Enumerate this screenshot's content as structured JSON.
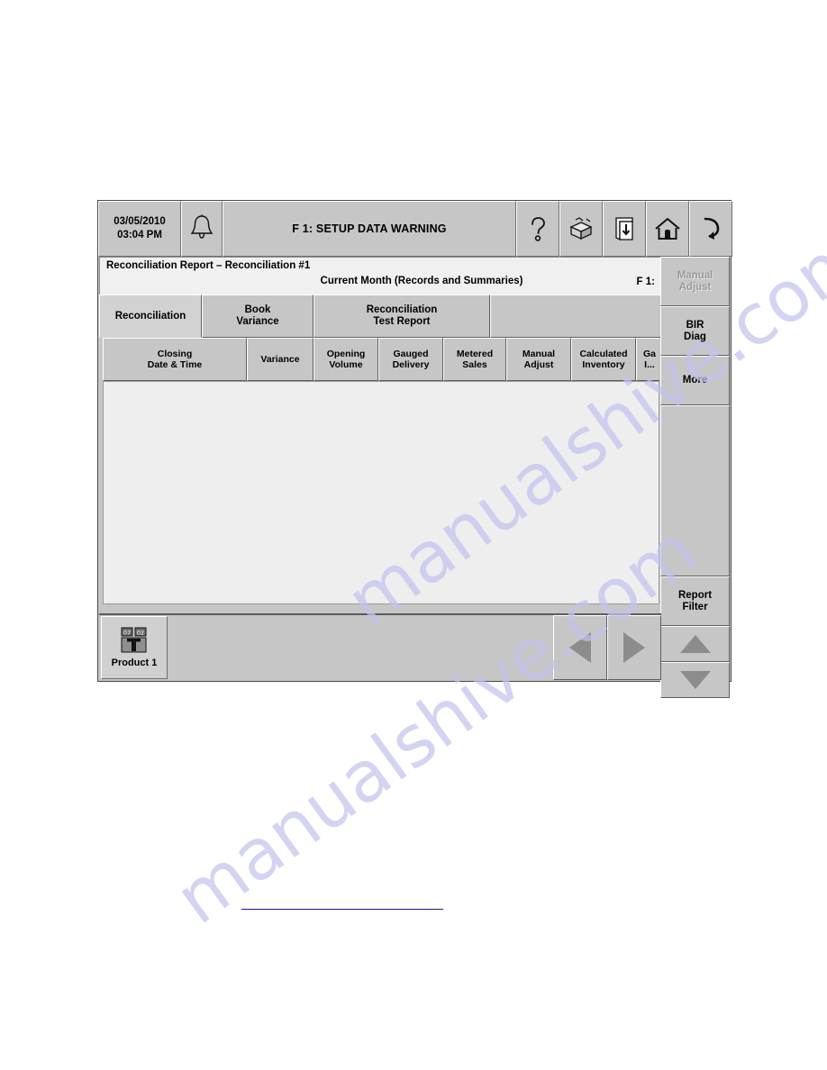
{
  "watermark": {
    "line1": "manualshive.com",
    "line2": "manualshive.com",
    "color": "#c3c3ee"
  },
  "console": {
    "statusbar": {
      "date": "03/05/2010",
      "time": "03:04 PM",
      "alarm_icon": "bell-icon",
      "message": "F 1: SETUP DATA WARNING",
      "icons": [
        {
          "name": "help-icon",
          "glyph": "?"
        },
        {
          "name": "package-delivery-icon",
          "glyph": "box"
        },
        {
          "name": "print-report-icon",
          "glyph": "printout"
        },
        {
          "name": "home-icon",
          "glyph": "house"
        },
        {
          "name": "back-return-icon",
          "glyph": "return-arrow"
        }
      ]
    },
    "report": {
      "title": "Reconciliation Report  –  Reconciliation #1",
      "subtitle": "Current Month (Records and Summaries)",
      "alarm_ref": "F 1:"
    },
    "tabs": [
      {
        "label": "Reconciliation",
        "active": true
      },
      {
        "label": "Book\nVariance",
        "line1": "Book",
        "line2": "Variance",
        "active": false
      },
      {
        "label": "Reconciliation Test Report",
        "line1": "Reconciliation",
        "line2": "Test Report",
        "active": false
      },
      {
        "label": "",
        "line1": "",
        "line2": "",
        "active": false
      }
    ],
    "table": {
      "columns": [
        {
          "line1": "Closing",
          "line2": "Date & Time"
        },
        {
          "line1": "Variance",
          "line2": ""
        },
        {
          "line1": "Opening",
          "line2": "Volume"
        },
        {
          "line1": "Gauged",
          "line2": "Delivery"
        },
        {
          "line1": "Metered",
          "line2": "Sales"
        },
        {
          "line1": "Manual",
          "line2": "Adjust"
        },
        {
          "line1": "Calculated",
          "line2": "Inventory"
        },
        {
          "line1": "Ga",
          "line2": "I..."
        }
      ],
      "rows": []
    },
    "sidebar": [
      {
        "line1": "Manual",
        "line2": "Adjust",
        "disabled": true
      },
      {
        "line1": "BIR",
        "line2": "Diag",
        "disabled": false
      },
      {
        "line1": "More",
        "line2": "",
        "disabled": false
      },
      {
        "line1": "",
        "line2": "",
        "disabled": false
      },
      {
        "line1": "Report",
        "line2": "Filter",
        "disabled": false
      }
    ],
    "scroll": {
      "up_icon": "triangle-up-icon",
      "down_icon": "triangle-down-icon"
    },
    "bottombar": {
      "product": {
        "label": "Product 1",
        "icon": "tank-product-icon",
        "badge_left": "07",
        "badge_right": "02"
      },
      "prev_icon": "triangle-left-icon",
      "next_icon": "triangle-right-icon"
    }
  }
}
